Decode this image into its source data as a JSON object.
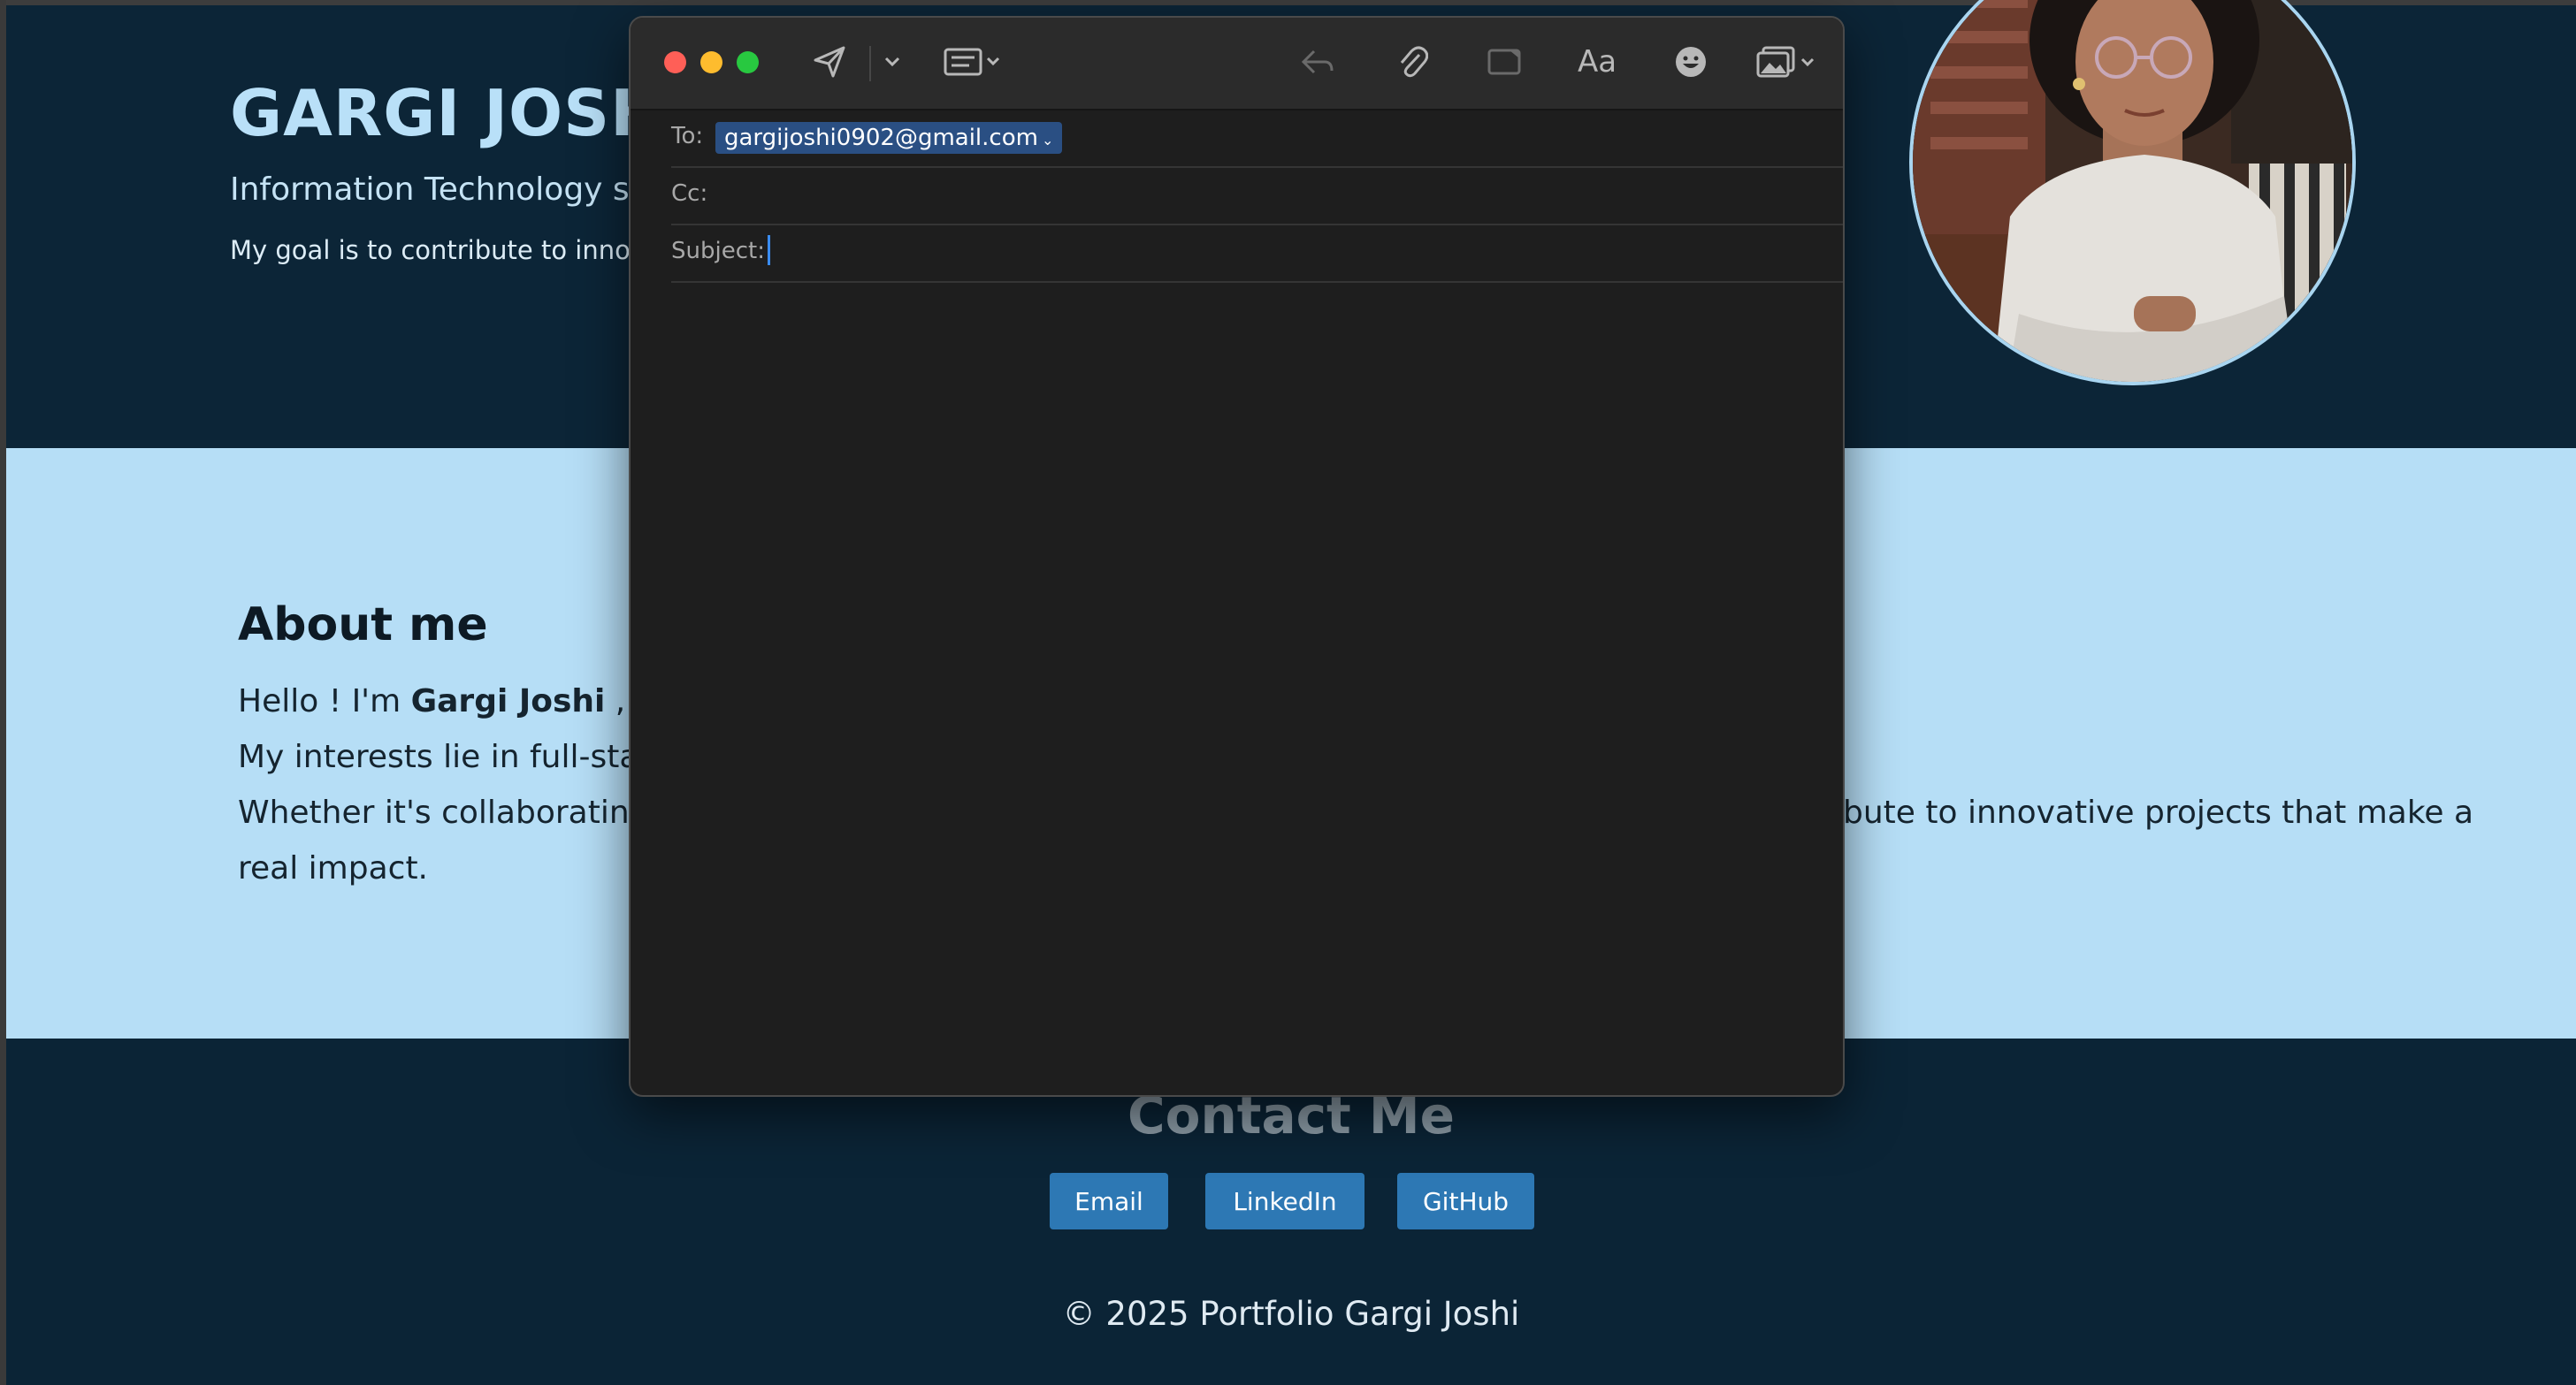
{
  "page": {
    "name": "GARGI JOSHI",
    "subtitle": "Information Technology s",
    "goal": "My goal is to contribute to innov"
  },
  "about": {
    "title": "About me",
    "line1_prefix": "Hello ! I'm ",
    "line1_name": "Gargi Joshi",
    "line1_suffix": " , I'",
    "line2": "My interests lie in full-sta",
    "line3_left": "Whether it's collaborating",
    "line3_right": "bute to innovative projects that make a",
    "line4": "real impact."
  },
  "contact": {
    "title": "Contact Me",
    "buttons": [
      {
        "label": "Email"
      },
      {
        "label": "LinkedIn"
      },
      {
        "label": "GitHub"
      }
    ],
    "footer": "© 2025 Portfolio Gargi Joshi"
  },
  "mail": {
    "to_label": "To:",
    "to_value": "gargijoshi0902@gmail.com",
    "cc_label": "Cc:",
    "subject_label": "Subject:",
    "toolbar_icons": [
      "send-icon",
      "chevron-down-icon",
      "header-fields-icon",
      "reply-icon",
      "attachment-icon",
      "markup-icon",
      "format-icon",
      "emoji-icon",
      "photo-browser-icon"
    ],
    "format_label": "Aa"
  },
  "colors": {
    "header_bg": "#0c2537",
    "about_bg": "#b6def6",
    "contact_bg": "#0b2436",
    "button_bg": "#2d78b4",
    "mail_bg": "#1e1e1e",
    "close": "#ff5f57",
    "minimize": "#febc2e",
    "zoom": "#28c840"
  }
}
